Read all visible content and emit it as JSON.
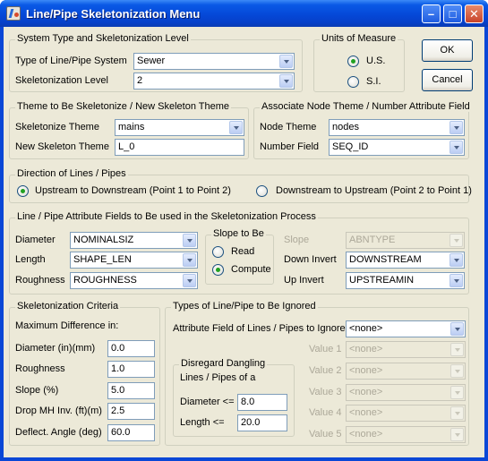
{
  "window": {
    "title": "Line/Pipe Skeletonization Menu"
  },
  "titlebar_buttons": {
    "minimize": "–",
    "maximize": "□",
    "close": "✕"
  },
  "system": {
    "title": "System Type and Skeletonization Level",
    "type_label": "Type of Line/Pipe System",
    "type_value": "Sewer",
    "level_label": "Skeletonization Level",
    "level_value": "2"
  },
  "units": {
    "title": "Units of Measure",
    "us": "U.S.",
    "si": "S.I.",
    "selected": "U.S."
  },
  "buttons": {
    "ok": "OK",
    "cancel": "Cancel"
  },
  "theme": {
    "title": "Theme to Be Skeletonize / New Skeleton Theme",
    "skel_label": "Skeletonize Theme",
    "skel_value": "mains",
    "new_label": "New Skeleton Theme",
    "new_value": "L_0"
  },
  "node": {
    "title": "Associate Node Theme / Number Attribute Field",
    "theme_label": "Node Theme",
    "theme_value": "nodes",
    "field_label": "Number Field",
    "field_value": "SEQ_ID"
  },
  "direction": {
    "title": "Direction of Lines / Pipes",
    "up": "Upstream to Downstream (Point 1 to Point 2)",
    "down": "Downstream to Upstream (Point 2 to Point 1)",
    "selected": "up"
  },
  "attributes": {
    "title": "Line / Pipe Attribute Fields to Be used in the Skeletonization Process",
    "diameter_label": "Diameter",
    "diameter_value": "NOMINALSIZ",
    "length_label": "Length",
    "length_value": "SHAPE_LEN",
    "roughness_label": "Roughness",
    "roughness_value": "ROUGHNESS",
    "slope_group_title": "Slope to Be",
    "read": "Read",
    "compute": "Compute",
    "slope_selected": "Compute",
    "slope_label": "Slope",
    "slope_value": "ABNTYPE",
    "down_label": "Down Invert",
    "down_value": "DOWNSTREAM",
    "up_label": "Up Invert",
    "up_value": "UPSTREAMIN"
  },
  "criteria": {
    "title": "Skeletonization Criteria",
    "heading": "Maximum Difference in:",
    "diameter_label": "Diameter (in)(mm)",
    "diameter_value": "0.0",
    "roughness_label": "Roughness",
    "roughness_value": "1.0",
    "slope_label": "Slope (%)",
    "slope_value": "5.0",
    "drop_label": "Drop MH Inv. (ft)(m)",
    "drop_value": "2.5",
    "deflect_label": "Deflect. Angle (deg)",
    "deflect_value": "60.0"
  },
  "ignored": {
    "title": "Types of Line/Pipe to Be Ignored",
    "attr_label": "Attribute Field of Lines / Pipes to Ignore",
    "attr_value": "<none>",
    "dangling_title": "Disregard Dangling",
    "dangling_sub": "Lines / Pipes of a",
    "diam_label": "Diameter <=",
    "diam_value": "8.0",
    "len_label": "Length <=",
    "len_value": "20.0",
    "values": [
      {
        "label": "Value 1",
        "value": "<none>"
      },
      {
        "label": "Value 2",
        "value": "<none>"
      },
      {
        "label": "Value 3",
        "value": "<none>"
      },
      {
        "label": "Value 4",
        "value": "<none>"
      },
      {
        "label": "Value 5",
        "value": "<none>"
      }
    ]
  }
}
